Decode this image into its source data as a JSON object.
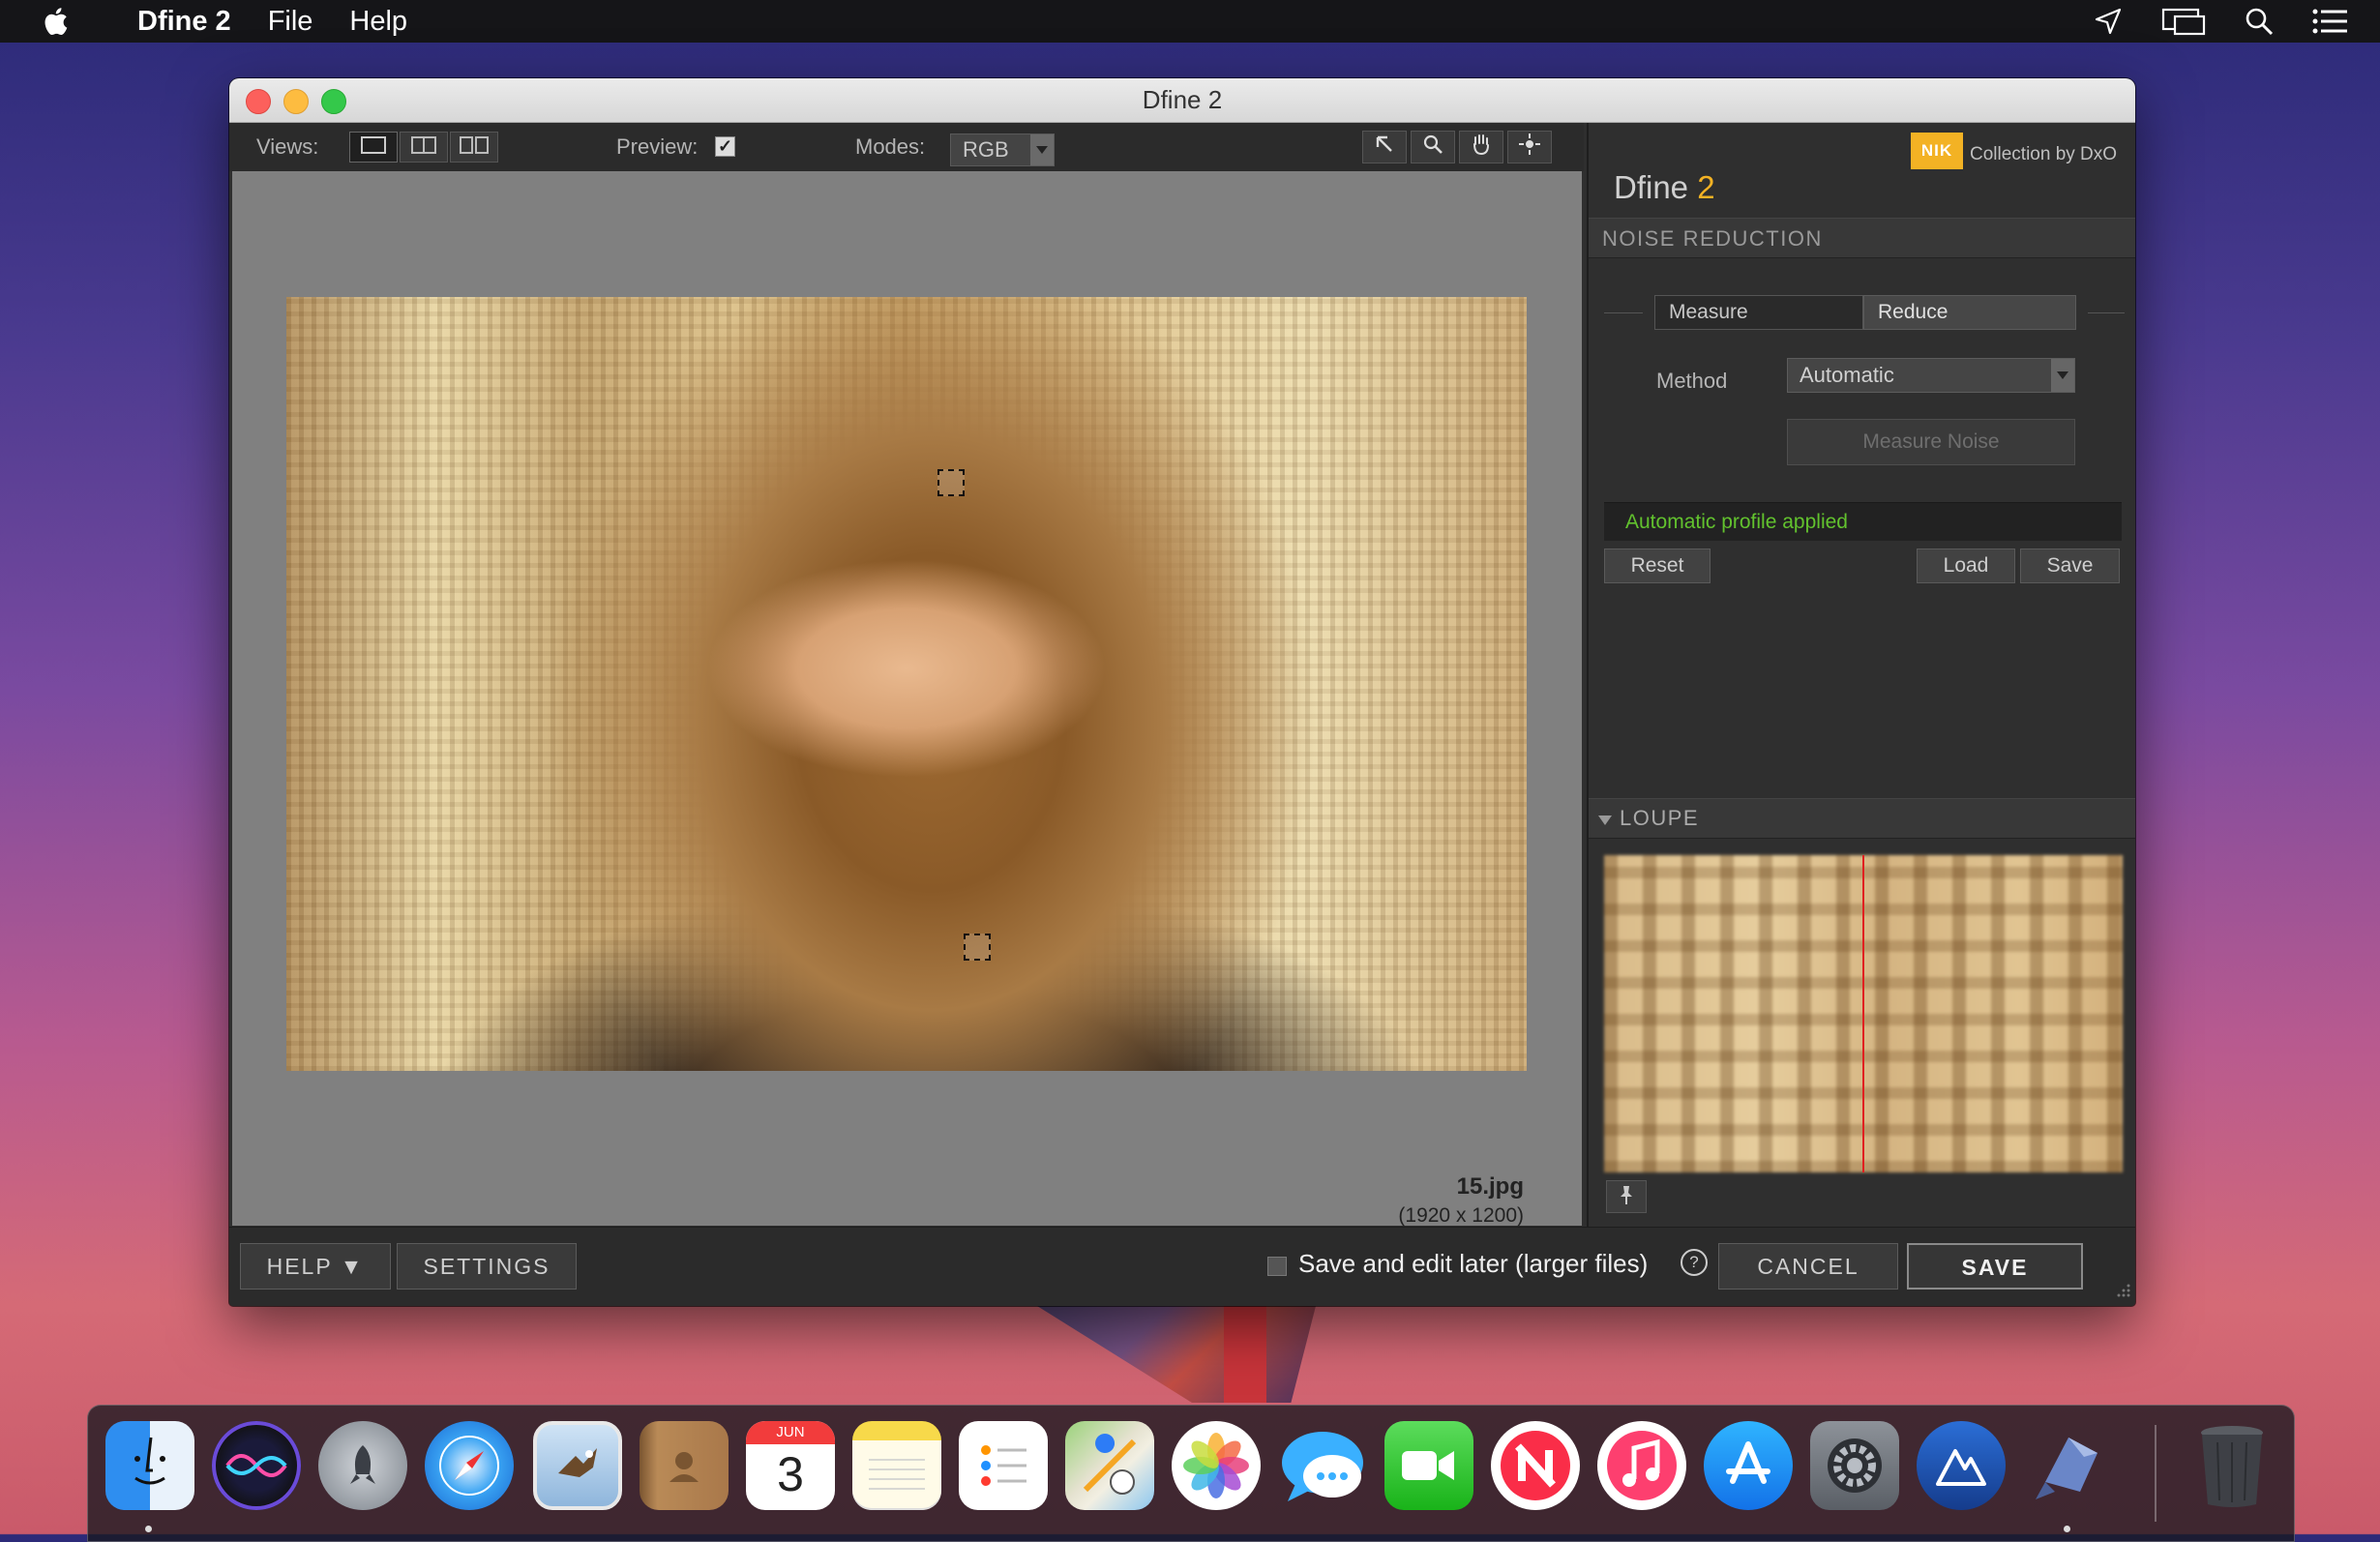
{
  "menubar": {
    "app_name": "Dfine 2",
    "items": [
      "File",
      "Help"
    ],
    "icons": [
      "apple-icon",
      "location-arrow-icon",
      "display-mirroring-icon",
      "spotlight-search-icon",
      "notification-list-icon"
    ]
  },
  "window": {
    "title": "Dfine 2",
    "toolbar": {
      "views_label": "Views:",
      "preview_label": "Preview:",
      "preview_checked": true,
      "preview_check_glyph": "✓",
      "modes_label": "Modes:",
      "mode_value": "RGB"
    },
    "image": {
      "filename": "15.jpg",
      "dimensions": "(1920 x 1200)"
    },
    "panel": {
      "brand_logo": "NIK",
      "collection_text": "Collection by DxO",
      "product_name": "Dfine",
      "product_version": "2",
      "noise_reduction_header": "NOISE REDUCTION",
      "tabs": [
        "Measure",
        "Reduce"
      ],
      "active_tab": "Reduce",
      "method_label": "Method",
      "method_value": "Automatic",
      "measure_noise_label": "Measure Noise",
      "status_text": "Automatic profile applied",
      "reset_label": "Reset",
      "load_label": "Load",
      "save_label": "Save",
      "loupe_header": "LOUPE"
    },
    "bottom": {
      "help_label": "HELP ▼",
      "settings_label": "SETTINGS",
      "save_later_label": "Save and edit later (larger files)",
      "save_later_checked": false,
      "help_symbol": "?",
      "cancel_label": "CANCEL",
      "save_label": "SAVE"
    }
  },
  "dock": {
    "apps": [
      "Finder",
      "Siri",
      "Launchpad",
      "Safari",
      "Mail",
      "Contacts",
      "Calendar",
      "Notes",
      "Reminders",
      "Maps",
      "Photos",
      "Messages",
      "FaceTime",
      "News",
      "Music",
      "App Store",
      "System Preferences",
      "Affinity",
      "Dfine 2",
      "Trash"
    ],
    "calendar_month": "JUN",
    "calendar_day": "3"
  }
}
